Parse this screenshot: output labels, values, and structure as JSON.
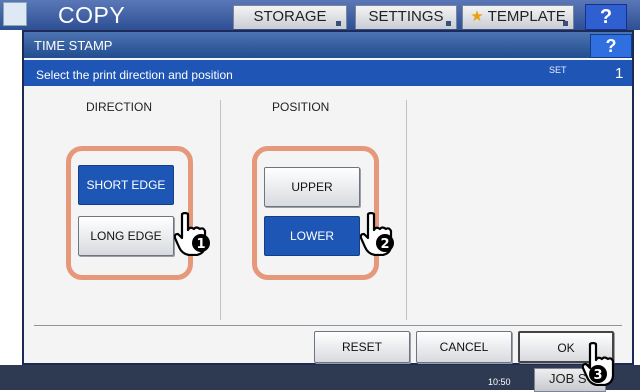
{
  "app": {
    "title": "COPY",
    "tabs": [
      {
        "label": "STORAGE"
      },
      {
        "label": "SETTINGS"
      },
      {
        "label": "TEMPLATE"
      }
    ],
    "help_label": "?",
    "jobs_label": "JOB S",
    "clock": "10:50"
  },
  "dialog": {
    "title": "TIME STAMP",
    "help_label": "?",
    "instruction": "Select the print direction and position",
    "set_label": "SET",
    "set_number": "1",
    "direction": {
      "label": "DIRECTION",
      "options": [
        {
          "label": "SHORT EDGE",
          "selected": true
        },
        {
          "label": "LONG EDGE",
          "selected": false
        }
      ]
    },
    "position": {
      "label": "POSITION",
      "options": [
        {
          "label": "UPPER",
          "selected": false
        },
        {
          "label": "LOWER",
          "selected": true
        }
      ]
    },
    "buttons": {
      "reset": "RESET",
      "cancel": "CANCEL",
      "ok": "OK"
    }
  },
  "annotations": {
    "step_1": "1",
    "step_2": "2",
    "step_3": "3",
    "highlight_color": "#e6987b"
  },
  "colors": {
    "selected": "#1e56b5",
    "title_bar": "#214c8f"
  }
}
